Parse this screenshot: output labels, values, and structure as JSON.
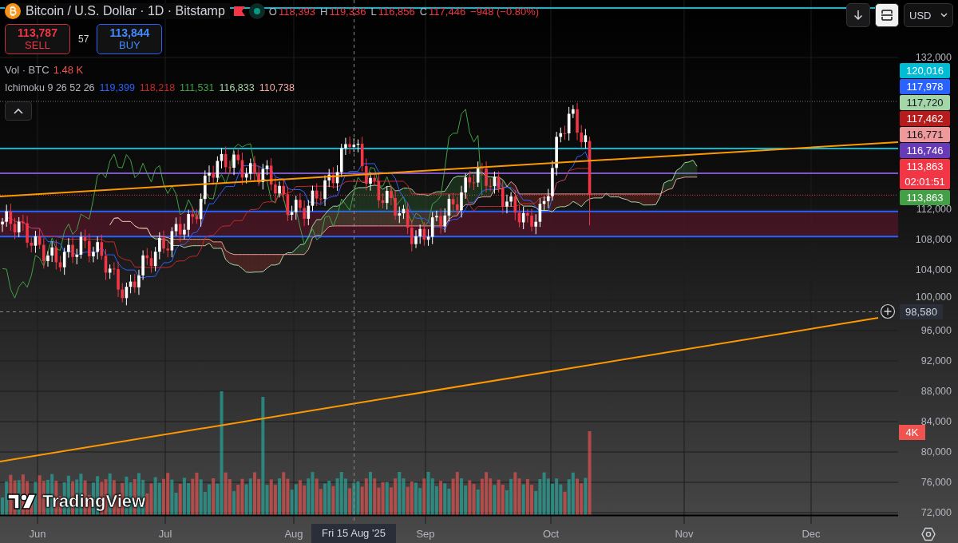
{
  "header": {
    "title": "Bitcoin / U.S. Dollar · 1D · Bitstamp",
    "negative": true,
    "ohlc": [
      {
        "label": "O",
        "value": "118,393"
      },
      {
        "label": "H",
        "value": "119,336"
      },
      {
        "label": "L",
        "value": "116,856"
      },
      {
        "label": "C",
        "value": "117,446"
      }
    ],
    "change": "−948 (−0.80%)"
  },
  "trade": {
    "sell": {
      "price": "113,787",
      "label": "SELL"
    },
    "spread": "57",
    "buy": {
      "price": "113,844",
      "label": "BUY"
    }
  },
  "volume_legend": {
    "name": "Vol · BTC",
    "value": "1.48 K"
  },
  "ichimoku_legend": {
    "name": "Ichimoku 9 26 52 26",
    "values": [
      {
        "text": "119,399",
        "color": "#2962ff"
      },
      {
        "text": "118,218",
        "color": "#c62828"
      },
      {
        "text": "111,531",
        "color": "#43a047"
      },
      {
        "text": "116,833",
        "color": "#a5d6a7"
      },
      {
        "text": "110,738",
        "color": "#f7a9a7"
      }
    ]
  },
  "toolbar": {
    "currency": "USD"
  },
  "price_axis": {
    "ticks": [
      "132,000",
      "112,000",
      "108,000",
      "104,000",
      "100,000",
      "96,000",
      "92,000",
      "88,000",
      "84,000",
      "80,000",
      "76,000",
      "72,000"
    ],
    "tags": [
      {
        "lines": [
          "120,016"
        ],
        "color": "#00bcd4"
      },
      {
        "lines": [
          "117,978"
        ],
        "color": "#2962ff"
      },
      {
        "lines": [
          "117,720"
        ],
        "color": "#a5d6a7"
      },
      {
        "lines": [
          "117,462"
        ],
        "color": "#b71c1c"
      },
      {
        "lines": [
          "116,771"
        ],
        "color": "#ef9a9a"
      },
      {
        "lines": [
          "116,746"
        ],
        "color": "#673ab7"
      },
      {
        "lines": [
          "113,863",
          "02:01:51"
        ],
        "color": "#f23645"
      },
      {
        "lines": [
          "113,863"
        ],
        "color": "#43a047"
      }
    ],
    "crosshair_price": "98,580",
    "volume_tag": "4K"
  },
  "time_axis": {
    "labels": [
      "Jun",
      "Jul",
      "Aug",
      "Sep",
      "Oct",
      "Nov",
      "Dec"
    ],
    "crosshair_date": "Fri 15 Aug '25"
  },
  "logo": {
    "text": "TradingView"
  }
}
